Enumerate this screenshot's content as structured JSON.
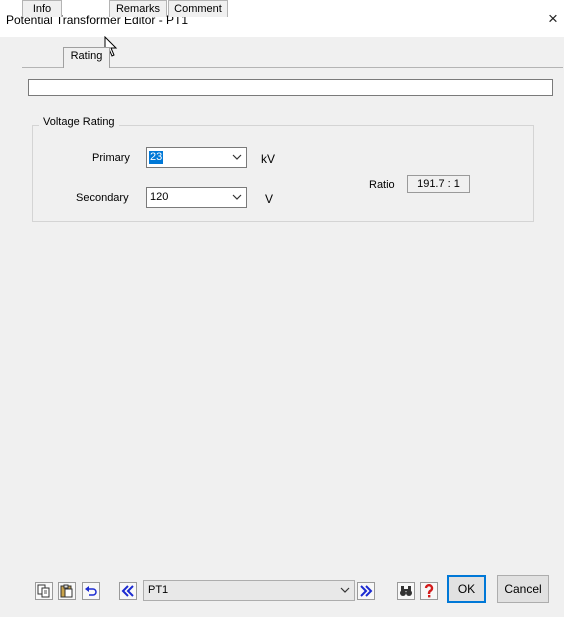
{
  "window": {
    "title": "Potential Transformer Editor - PT1",
    "close_glyph": "×"
  },
  "tabs": [
    {
      "label": "Info",
      "active": false
    },
    {
      "label": "Rating",
      "active": true
    },
    {
      "label": "Remarks",
      "active": false
    },
    {
      "label": "Comment",
      "active": false
    }
  ],
  "rating": {
    "title_field_value": "",
    "group_label": "Voltage Rating",
    "primary": {
      "label": "Primary",
      "value": "23",
      "unit": "kV"
    },
    "secondary": {
      "label": "Secondary",
      "value": "120",
      "unit": "V"
    },
    "ratio": {
      "label": "Ratio",
      "value": "191.7 : 1"
    }
  },
  "bottom": {
    "icons": [
      "copy-icon",
      "paste-icon",
      "undo-icon",
      "prev-icon",
      "next-icon",
      "find-icon",
      "help-icon"
    ],
    "nav_value": "PT1",
    "ok_label": "OK",
    "cancel_label": "Cancel"
  },
  "colors": {
    "selection": "#0078d7",
    "nav_arrow": "#1c2bd1",
    "help": "#d21c1c",
    "dialog_bg": "#f0f0f0"
  }
}
